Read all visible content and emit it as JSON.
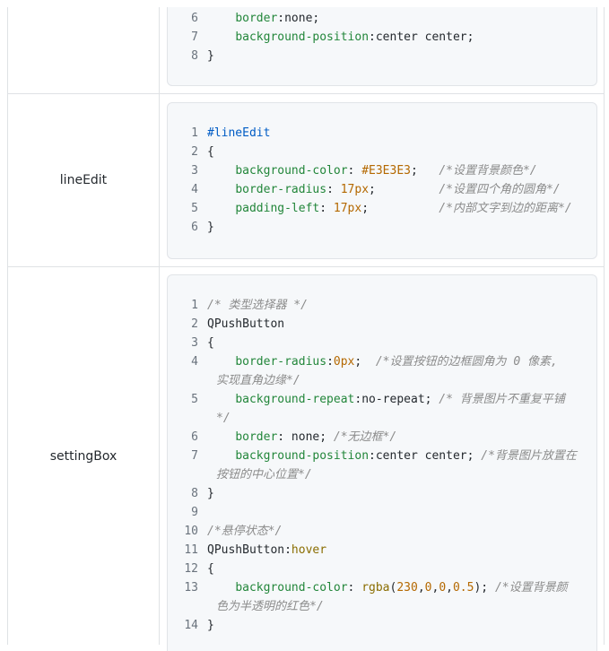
{
  "rows": [
    {
      "label": "",
      "lines": [
        {
          "n": "6",
          "parts": [
            {
              "t": "    ",
              "c": "plain"
            },
            {
              "t": "border",
              "c": "kw"
            },
            {
              "t": ":none;",
              "c": "plain"
            }
          ]
        },
        {
          "n": "7",
          "parts": [
            {
              "t": "    ",
              "c": "plain"
            },
            {
              "t": "background-position",
              "c": "kw"
            },
            {
              "t": ":center center;",
              "c": "plain"
            }
          ]
        },
        {
          "n": "8",
          "parts": [
            {
              "t": "}",
              "c": "plain"
            }
          ]
        }
      ]
    },
    {
      "label": "lineEdit",
      "lines": [
        {
          "n": "1",
          "parts": [
            {
              "t": "#lineEdit",
              "c": "sel"
            }
          ]
        },
        {
          "n": "2",
          "parts": [
            {
              "t": "{",
              "c": "plain"
            }
          ]
        },
        {
          "n": "3",
          "parts": [
            {
              "t": "    ",
              "c": "plain"
            },
            {
              "t": "background-color",
              "c": "kw"
            },
            {
              "t": ": ",
              "c": "plain"
            },
            {
              "t": "#E3E3E3",
              "c": "num"
            },
            {
              "t": ";   ",
              "c": "plain"
            },
            {
              "t": "/*设置背景颜色*/",
              "c": "cm"
            }
          ]
        },
        {
          "n": "4",
          "parts": [
            {
              "t": "    ",
              "c": "plain"
            },
            {
              "t": "border-radius",
              "c": "kw"
            },
            {
              "t": ": ",
              "c": "plain"
            },
            {
              "t": "17px",
              "c": "num"
            },
            {
              "t": ";         ",
              "c": "plain"
            },
            {
              "t": "/*设置四个角的圆角*/",
              "c": "cm"
            }
          ]
        },
        {
          "n": "5",
          "parts": [
            {
              "t": "    ",
              "c": "plain"
            },
            {
              "t": "padding-left",
              "c": "kw"
            },
            {
              "t": ": ",
              "c": "plain"
            },
            {
              "t": "17px",
              "c": "num"
            },
            {
              "t": ";          ",
              "c": "plain"
            },
            {
              "t": "/*内部文字到边的距离*/",
              "c": "cm"
            }
          ]
        },
        {
          "n": "6",
          "parts": [
            {
              "t": "}",
              "c": "plain"
            }
          ]
        }
      ]
    },
    {
      "label": "settingBox",
      "lines": [
        {
          "n": "1",
          "parts": [
            {
              "t": "/* 类型选择器 */",
              "c": "cm"
            }
          ]
        },
        {
          "n": "2",
          "parts": [
            {
              "t": "QPushButton",
              "c": "plain"
            }
          ]
        },
        {
          "n": "3",
          "parts": [
            {
              "t": "{",
              "c": "plain"
            }
          ]
        },
        {
          "n": "4",
          "parts": [
            {
              "t": "    ",
              "c": "plain"
            },
            {
              "t": "border-radius",
              "c": "kw"
            },
            {
              "t": ":",
              "c": "plain"
            },
            {
              "t": "0px",
              "c": "num"
            },
            {
              "t": ";  ",
              "c": "plain"
            },
            {
              "t": "/*设置按钮的边框圆角为 0 像素,",
              "c": "cm"
            }
          ],
          "cont": [
            {
              "t": "实现直角边缘*/",
              "c": "cm"
            }
          ]
        },
        {
          "n": "5",
          "parts": [
            {
              "t": "    ",
              "c": "plain"
            },
            {
              "t": "background-repeat",
              "c": "kw"
            },
            {
              "t": ":no-repeat; ",
              "c": "plain"
            },
            {
              "t": "/* 背景图片不重复平铺",
              "c": "cm"
            }
          ],
          "cont": [
            {
              "t": "*/",
              "c": "cm"
            }
          ]
        },
        {
          "n": "6",
          "parts": [
            {
              "t": "    ",
              "c": "plain"
            },
            {
              "t": "border",
              "c": "kw"
            },
            {
              "t": ": none; ",
              "c": "plain"
            },
            {
              "t": "/*无边框*/",
              "c": "cm"
            }
          ]
        },
        {
          "n": "7",
          "parts": [
            {
              "t": "    ",
              "c": "plain"
            },
            {
              "t": "background-position",
              "c": "kw"
            },
            {
              "t": ":center center; ",
              "c": "plain"
            },
            {
              "t": "/*背景图片放置在",
              "c": "cm"
            }
          ],
          "cont": [
            {
              "t": "按钮的中心位置*/",
              "c": "cm"
            }
          ]
        },
        {
          "n": "8",
          "parts": [
            {
              "t": "}",
              "c": "plain"
            }
          ]
        },
        {
          "n": "9",
          "parts": [
            {
              "t": "",
              "c": "plain"
            }
          ]
        },
        {
          "n": "10",
          "parts": [
            {
              "t": "/*悬停状态*/",
              "c": "cm"
            }
          ]
        },
        {
          "n": "11",
          "parts": [
            {
              "t": "QPushButton",
              "c": "plain"
            },
            {
              "t": ":",
              "c": "plain"
            },
            {
              "t": "hover",
              "c": "ps"
            }
          ]
        },
        {
          "n": "12",
          "parts": [
            {
              "t": "{",
              "c": "plain"
            }
          ]
        },
        {
          "n": "13",
          "parts": [
            {
              "t": "    ",
              "c": "plain"
            },
            {
              "t": "background-color",
              "c": "kw"
            },
            {
              "t": ": ",
              "c": "plain"
            },
            {
              "t": "rgba",
              "c": "ps"
            },
            {
              "t": "(",
              "c": "plain"
            },
            {
              "t": "230",
              "c": "num"
            },
            {
              "t": ",",
              "c": "plain"
            },
            {
              "t": "0",
              "c": "num"
            },
            {
              "t": ",",
              "c": "plain"
            },
            {
              "t": "0",
              "c": "num"
            },
            {
              "t": ",",
              "c": "plain"
            },
            {
              "t": "0.5",
              "c": "num"
            },
            {
              "t": "); ",
              "c": "plain"
            },
            {
              "t": "/*设置背景颜",
              "c": "cm"
            }
          ],
          "cont": [
            {
              "t": "色为半透明的红色*/",
              "c": "cm"
            }
          ]
        },
        {
          "n": "14",
          "parts": [
            {
              "t": "}",
              "c": "plain"
            }
          ]
        }
      ]
    }
  ]
}
